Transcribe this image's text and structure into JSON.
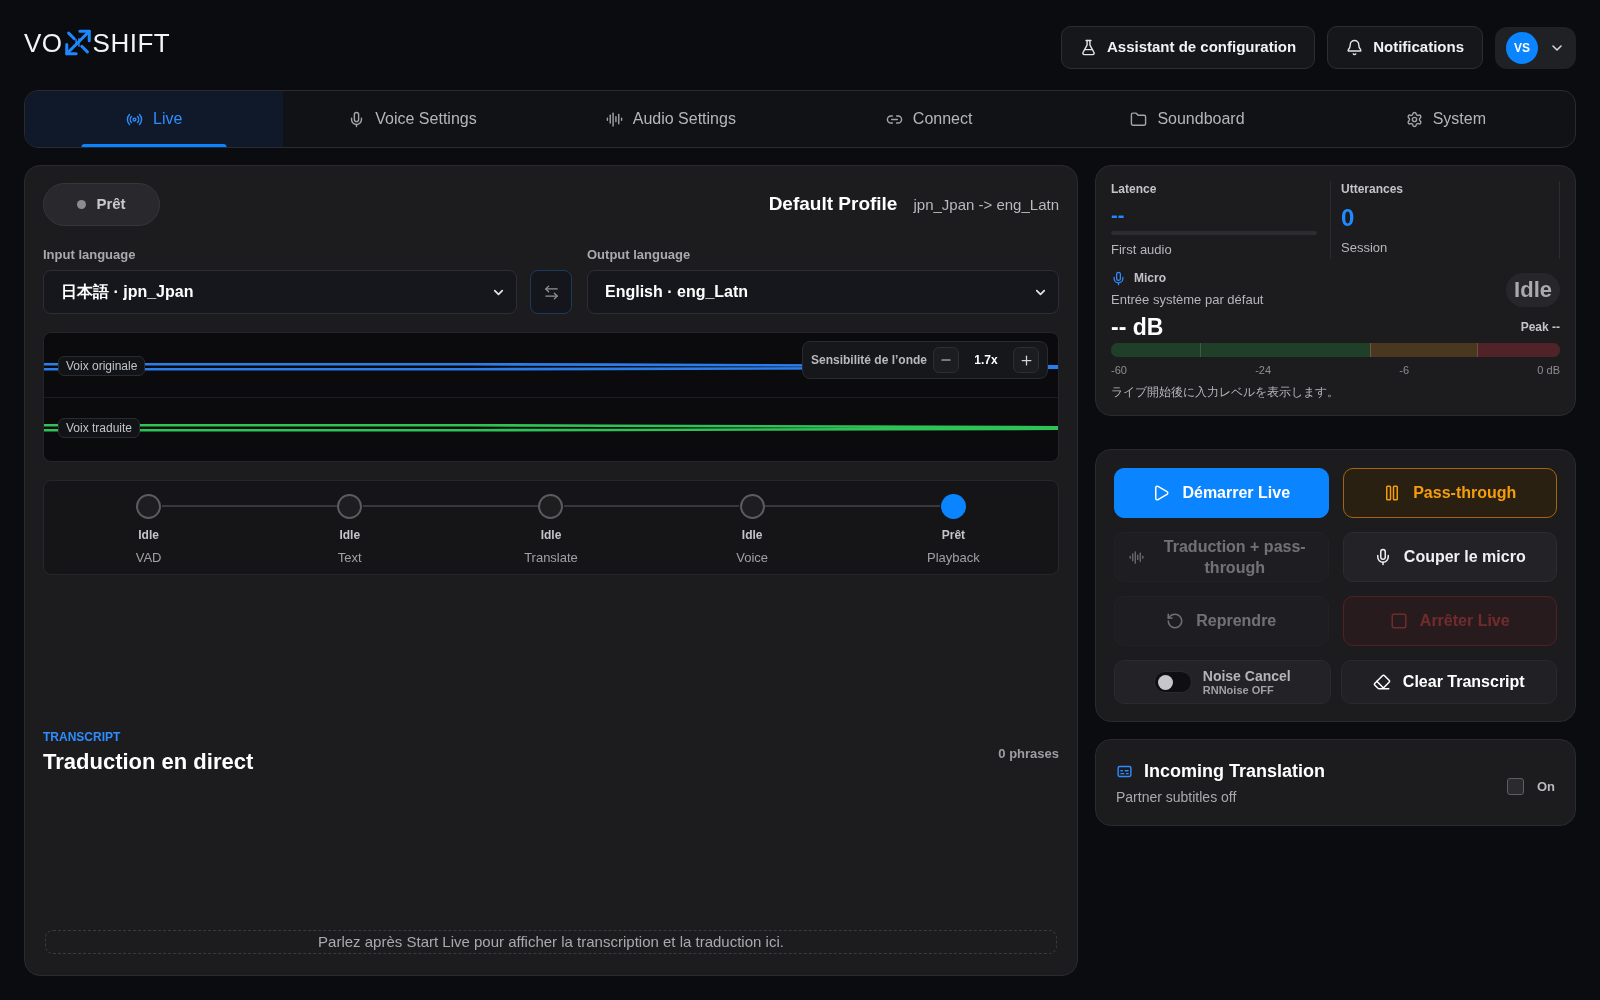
{
  "logo": {
    "left": "VO",
    "right": "SHIFT"
  },
  "header_buttons": [
    {
      "label": "Assistant de configuration",
      "kind": "wizard"
    },
    {
      "label": "Notifications",
      "kind": "notifications"
    }
  ],
  "user_menu": {
    "initials": "VS"
  },
  "tabs": [
    {
      "label": "Live",
      "kind": "live",
      "selected": true
    },
    {
      "label": "Voice Settings",
      "kind": "voice",
      "selected": false
    },
    {
      "label": "Audio Settings",
      "kind": "audio",
      "selected": false
    },
    {
      "label": "Connect",
      "kind": "connect",
      "selected": false
    },
    {
      "label": "Soundboard",
      "kind": "soundboard",
      "selected": false
    },
    {
      "label": "System",
      "kind": "system",
      "selected": false
    }
  ],
  "live": {
    "status": "Prêt",
    "profile": {
      "name": "Default Profile",
      "route": "jpn_Jpan -> eng_Latn"
    },
    "input_language": {
      "label": "Input language",
      "value": "日本語 · jpn_Jpan"
    },
    "output_language": {
      "label": "Output language",
      "value": "English · eng_Latn"
    },
    "waveform": {
      "lanes": [
        {
          "label": "Voix originale",
          "color": "#2b7de9"
        },
        {
          "label": "Voix traduite",
          "color": "#2fc257"
        }
      ],
      "sensitivity": {
        "label": "Sensibilité de l’onde",
        "value": "1.7x"
      }
    },
    "pipeline": [
      {
        "status": "Idle",
        "name": "VAD",
        "active": false
      },
      {
        "status": "Idle",
        "name": "Text",
        "active": false
      },
      {
        "status": "Idle",
        "name": "Translate",
        "active": false
      },
      {
        "status": "Idle",
        "name": "Voice",
        "active": false
      },
      {
        "status": "Prêt",
        "name": "Playback",
        "active": true
      }
    ],
    "transcript": {
      "eyebrow": "TRANSCRIPT",
      "title": "Traduction en direct",
      "count": "0 phrases",
      "empty_message": "Parlez après Start Live pour afficher la transcription et la traduction ici."
    }
  },
  "metrics": {
    "latency": {
      "label": "Latence",
      "value": "--",
      "caption": "First audio"
    },
    "utterances": {
      "label": "Utterances",
      "value": "0",
      "caption": "Session"
    },
    "microphone": {
      "label": "Micro",
      "device": "Entrée système par défaut",
      "state": "Idle",
      "reading": "-- dB",
      "peak": "Peak --",
      "scale": [
        "-60",
        "-24",
        "-6",
        "0 dB"
      ],
      "hint": "ライブ開始後に入力レベルを表示します。"
    }
  },
  "controls": [
    {
      "label": "Démarrer Live",
      "kind": "start",
      "disabled": false
    },
    {
      "label": "Pass-through",
      "kind": "passthrough",
      "disabled": false
    },
    {
      "label": "Traduction + pass-through",
      "kind": "mix",
      "disabled": true
    },
    {
      "label": "Couper le micro",
      "kind": "mute",
      "disabled": false
    },
    {
      "label": "Reprendre",
      "kind": "resume",
      "disabled": true
    },
    {
      "label": "Arrêter Live",
      "kind": "stop",
      "disabled": true
    }
  ],
  "noise_cancel": {
    "label": "Noise Cancel",
    "sublabel": "RNNoise OFF",
    "on": false
  },
  "clear_button": {
    "label": "Clear Transcript"
  },
  "incoming": {
    "title": "Incoming Translation",
    "subtitle": "Partner subtitles off",
    "toggle": {
      "label": "On",
      "checked": false
    }
  }
}
